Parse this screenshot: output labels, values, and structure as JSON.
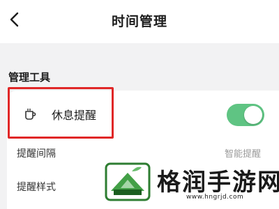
{
  "header": {
    "title": "时间管理",
    "back_icon": "chevron-left-icon"
  },
  "section": {
    "title": "管理工具"
  },
  "break_reminder": {
    "icon": "coffee-cup-icon",
    "label": "休息提醒",
    "enabled": true,
    "toggle_color": "#5fc483"
  },
  "settings": [
    {
      "label": "提醒间隔",
      "value": "智能提醒"
    },
    {
      "label": "提醒样式",
      "value": ""
    }
  ],
  "annotation": {
    "color": "#e02727"
  },
  "watermark": {
    "brand": "格润手游网",
    "url": "www.hngrjd.com"
  }
}
